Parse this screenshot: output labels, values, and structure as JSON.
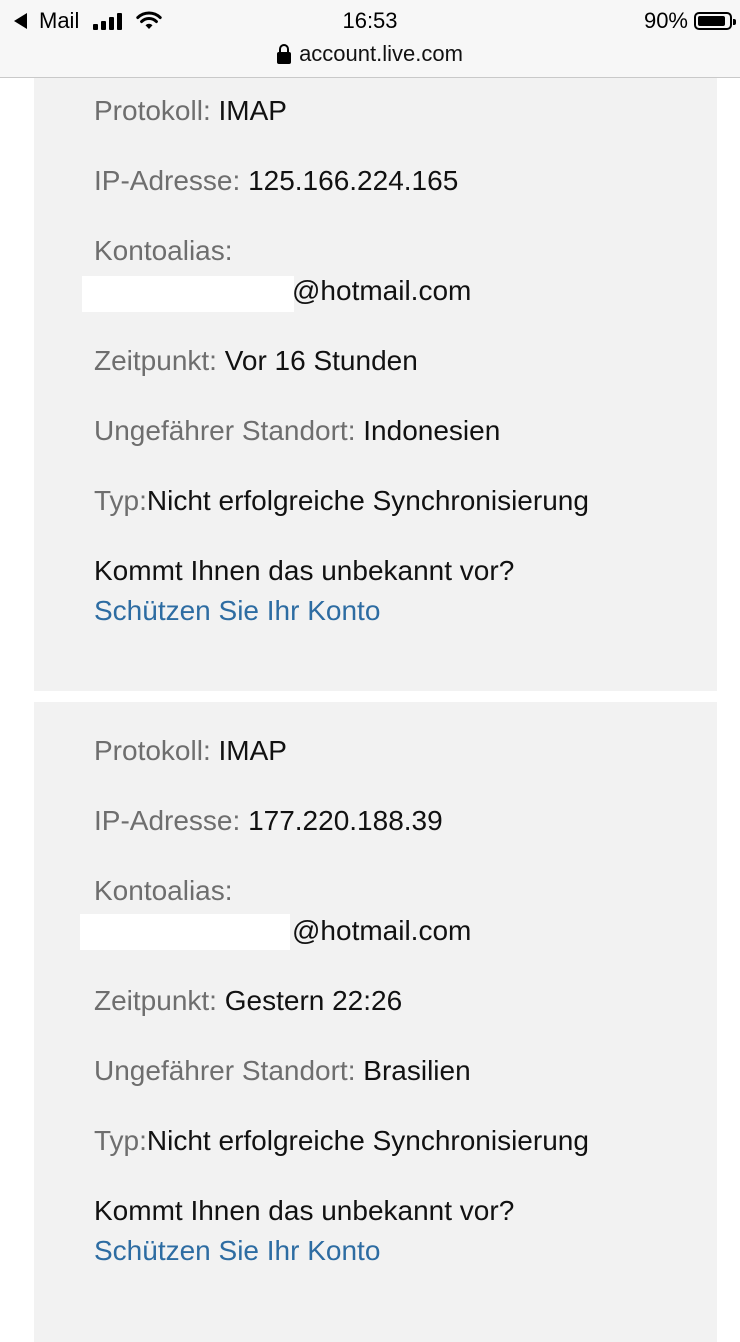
{
  "status_bar": {
    "back_app": "Mail",
    "time": "16:53",
    "battery": "90%",
    "battery_level": 0.9
  },
  "url_bar": {
    "domain": "account.live.com"
  },
  "events": [
    {
      "protocol_label": "Protokoll:",
      "protocol": "IMAP",
      "ip_label": "IP-Adresse:",
      "ip": "125.166.224.165",
      "alias_label": "Kontoalias:",
      "alias_visible": "@hotmail.com",
      "time_label": "Zeitpunkt:",
      "time": "Vor 16 Stunden",
      "location_label": "Ungefährer Standort:",
      "location": "Indonesien",
      "type_label": "Typ:",
      "type": "Nicht erfolgreiche Synchronisierung",
      "question": "Kommt Ihnen das unbekannt vor?",
      "protect_link": "Schützen Sie Ihr Konto"
    },
    {
      "protocol_label": "Protokoll:",
      "protocol": "IMAP",
      "ip_label": "IP-Adresse:",
      "ip": "177.220.188.39",
      "alias_label": "Kontoalias:",
      "alias_visible": "@hotmail.com",
      "time_label": "Zeitpunkt:",
      "time": "Gestern 22:26",
      "location_label": "Ungefährer Standort:",
      "location": "Brasilien",
      "type_label": "Typ:",
      "type": "Nicht erfolgreiche Synchronisierung",
      "question": "Kommt Ihnen das unbekannt vor?",
      "protect_link": "Schützen Sie Ihr Konto"
    }
  ]
}
